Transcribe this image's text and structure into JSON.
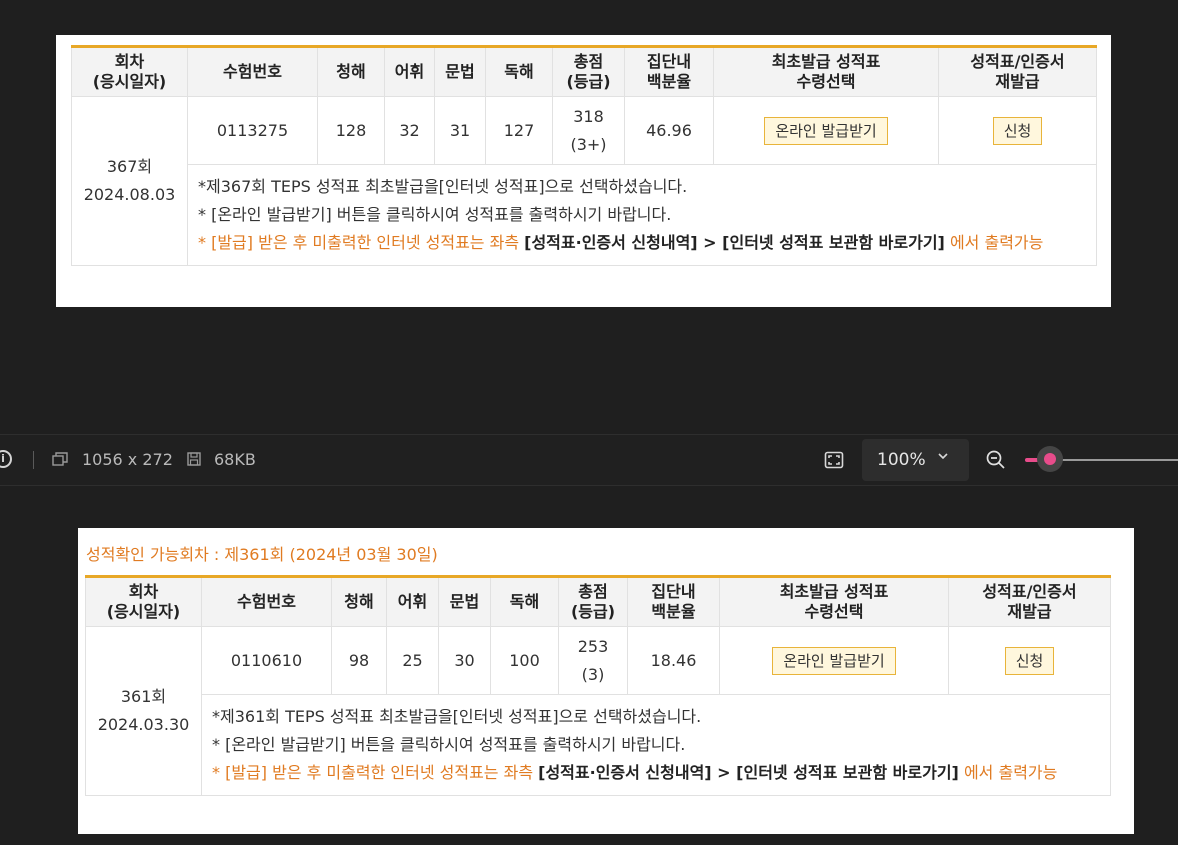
{
  "headers": {
    "round": "회차",
    "round_sub": "(응시일자)",
    "exam_no": "수험번호",
    "listening": "청해",
    "vocab": "어휘",
    "grammar": "문법",
    "reading": "독해",
    "total": "총점",
    "total_sub": "(등급)",
    "percentile": "집단내",
    "percentile_sub": "백분율",
    "first_issue": "최초발급 성적표",
    "first_issue_sub": "수령선택",
    "reissue": "성적표/인증서",
    "reissue_sub": "재발급"
  },
  "record1": {
    "round": "367회",
    "date": "2024.08.03",
    "exam_no": "0113275",
    "listening": "128",
    "vocab": "32",
    "grammar": "31",
    "reading": "127",
    "total": "318",
    "grade": "(3+)",
    "percentile": "46.96",
    "online_button": "온라인 발급받기",
    "apply_button": "신청",
    "note1": "*제367회 TEPS 성적표 최초발급을[인터넷 성적표]으로 선택하셨습니다.",
    "note2": "* [온라인 발급받기] 버튼을 클릭하시여 성적표를 출력하시기 바랍니다.",
    "note3_a": "* [발급] 받은 후 미출력한 인터넷 성적표는 좌측 ",
    "note3_b": "[성적표·인증서 신청내역] > [인터넷 성적표 보관함 바로가기]",
    "note3_c": " 에서 출력가능"
  },
  "toolbar": {
    "info_glyph": "i",
    "dimensions": "1056 x 272",
    "filesize": "68KB",
    "zoom": "100%",
    "zoom_level": 0.25
  },
  "panel2": {
    "title": "성적확인 가능회차 : 제361회 (2024년 03월 30일)"
  },
  "record2": {
    "round": "361회",
    "date": "2024.03.30",
    "exam_no": "0110610",
    "listening": "98",
    "vocab": "25",
    "grammar": "30",
    "reading": "100",
    "total": "253",
    "grade": "(3)",
    "percentile": "18.46",
    "online_button": "온라인 발급받기",
    "apply_button": "신청",
    "note1": "*제361회 TEPS 성적표 최초발급을[인터넷 성적표]으로 선택하셨습니다.",
    "note2": "* [온라인 발급받기] 버튼을 클릭하시여 성적표를 출력하시기 바랍니다.",
    "note3_a": "* [발급] 받은 후 미출력한 인터넷 성적표는 좌측 ",
    "note3_b": "[성적표·인증서 신청내역] > [인터넷 성적표 보관함 바로가기]",
    "note3_c": " 에서 출력가능"
  },
  "colors": {
    "accent_border": "#e8a827",
    "orange_text": "#e07b22",
    "slider_pink": "#e84c8b"
  }
}
